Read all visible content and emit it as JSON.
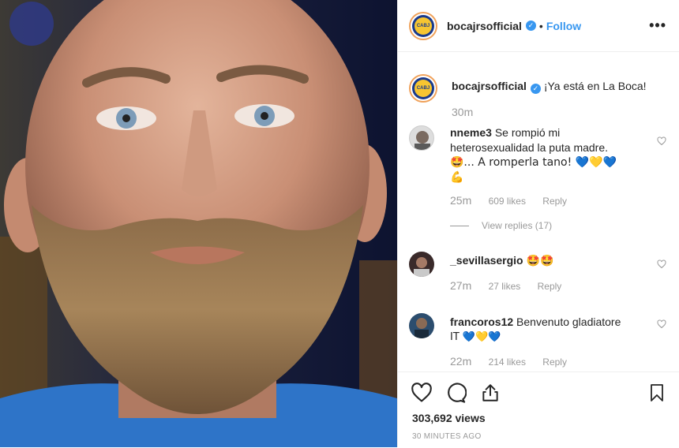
{
  "post": {
    "username": "bocajrsofficial",
    "follow_label": "Follow",
    "separator": "•",
    "more_label": "•••",
    "avatar_text": "CABJ"
  },
  "caption": {
    "username": "bocajrsofficial",
    "text": "¡Ya está en La Boca!",
    "time": "30m"
  },
  "comments": [
    {
      "username": "nneme3",
      "text": "Se rompió mi heterosexualidad la puta madre.",
      "text2": "🤩... A romperla tano! 💙💛💙",
      "text3": "💪",
      "time": "25m",
      "likes": "609 likes",
      "reply": "Reply",
      "view_replies": "View replies (17)"
    },
    {
      "username": "_sevillasergio",
      "text": "🤩🤩",
      "time": "27m",
      "likes": "27 likes",
      "reply": "Reply"
    },
    {
      "username": "francoros12",
      "text": "Benvenuto gladiatore",
      "text2": "IT 💙💛💙",
      "time": "22m",
      "likes": "214 likes",
      "reply": "Reply"
    }
  ],
  "footer": {
    "views": "303,692 views",
    "ago": "30 MINUTES AGO"
  },
  "icons": {
    "like": "heart-icon",
    "comment": "comment-icon",
    "share": "share-icon",
    "save": "bookmark-icon",
    "verified": "verified-badge-icon",
    "more": "more-options-icon"
  },
  "colors": {
    "link": "#3897f0",
    "muted": "#999999",
    "border": "#efefef",
    "boca_blue": "#1a3a8c",
    "boca_gold": "#f7c531"
  }
}
